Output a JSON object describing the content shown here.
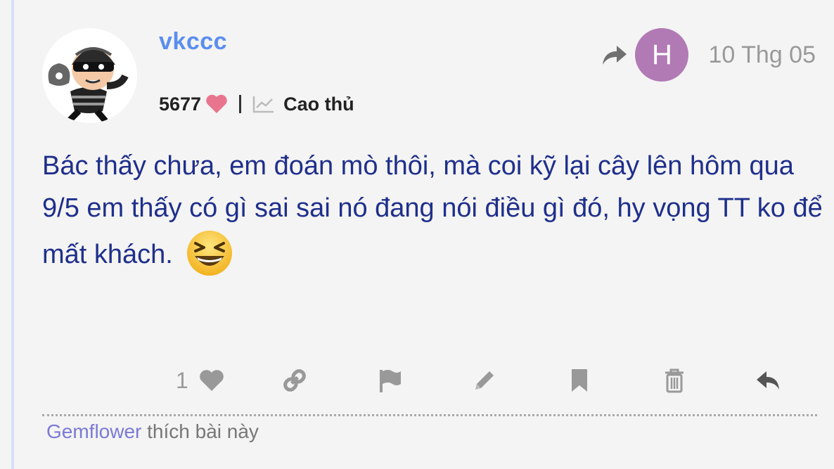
{
  "post": {
    "author": "vkccc",
    "reputation": "5677",
    "rank": "Cao thủ",
    "date": "10 Thg 05",
    "reply_to_avatar_letter": "H",
    "body": "Bác thấy chưa, em đoán mò thôi, mà coi kỹ lại cây lên hôm qua 9/5 em thấy có gì sai sai nó đang nói điều gì đó, hy vọng TT ko để mất khách.",
    "emoji": "laughing-face-icon"
  },
  "actions": {
    "like_count": "1"
  },
  "likes": {
    "user": "Gemflower",
    "suffix": " thích bài này"
  },
  "colors": {
    "username": "#5b8ef0",
    "body_text": "#1f2f8c",
    "reply_avatar": "#b17ab4",
    "heart": "#e9748e",
    "liker": "#7b79d8"
  }
}
